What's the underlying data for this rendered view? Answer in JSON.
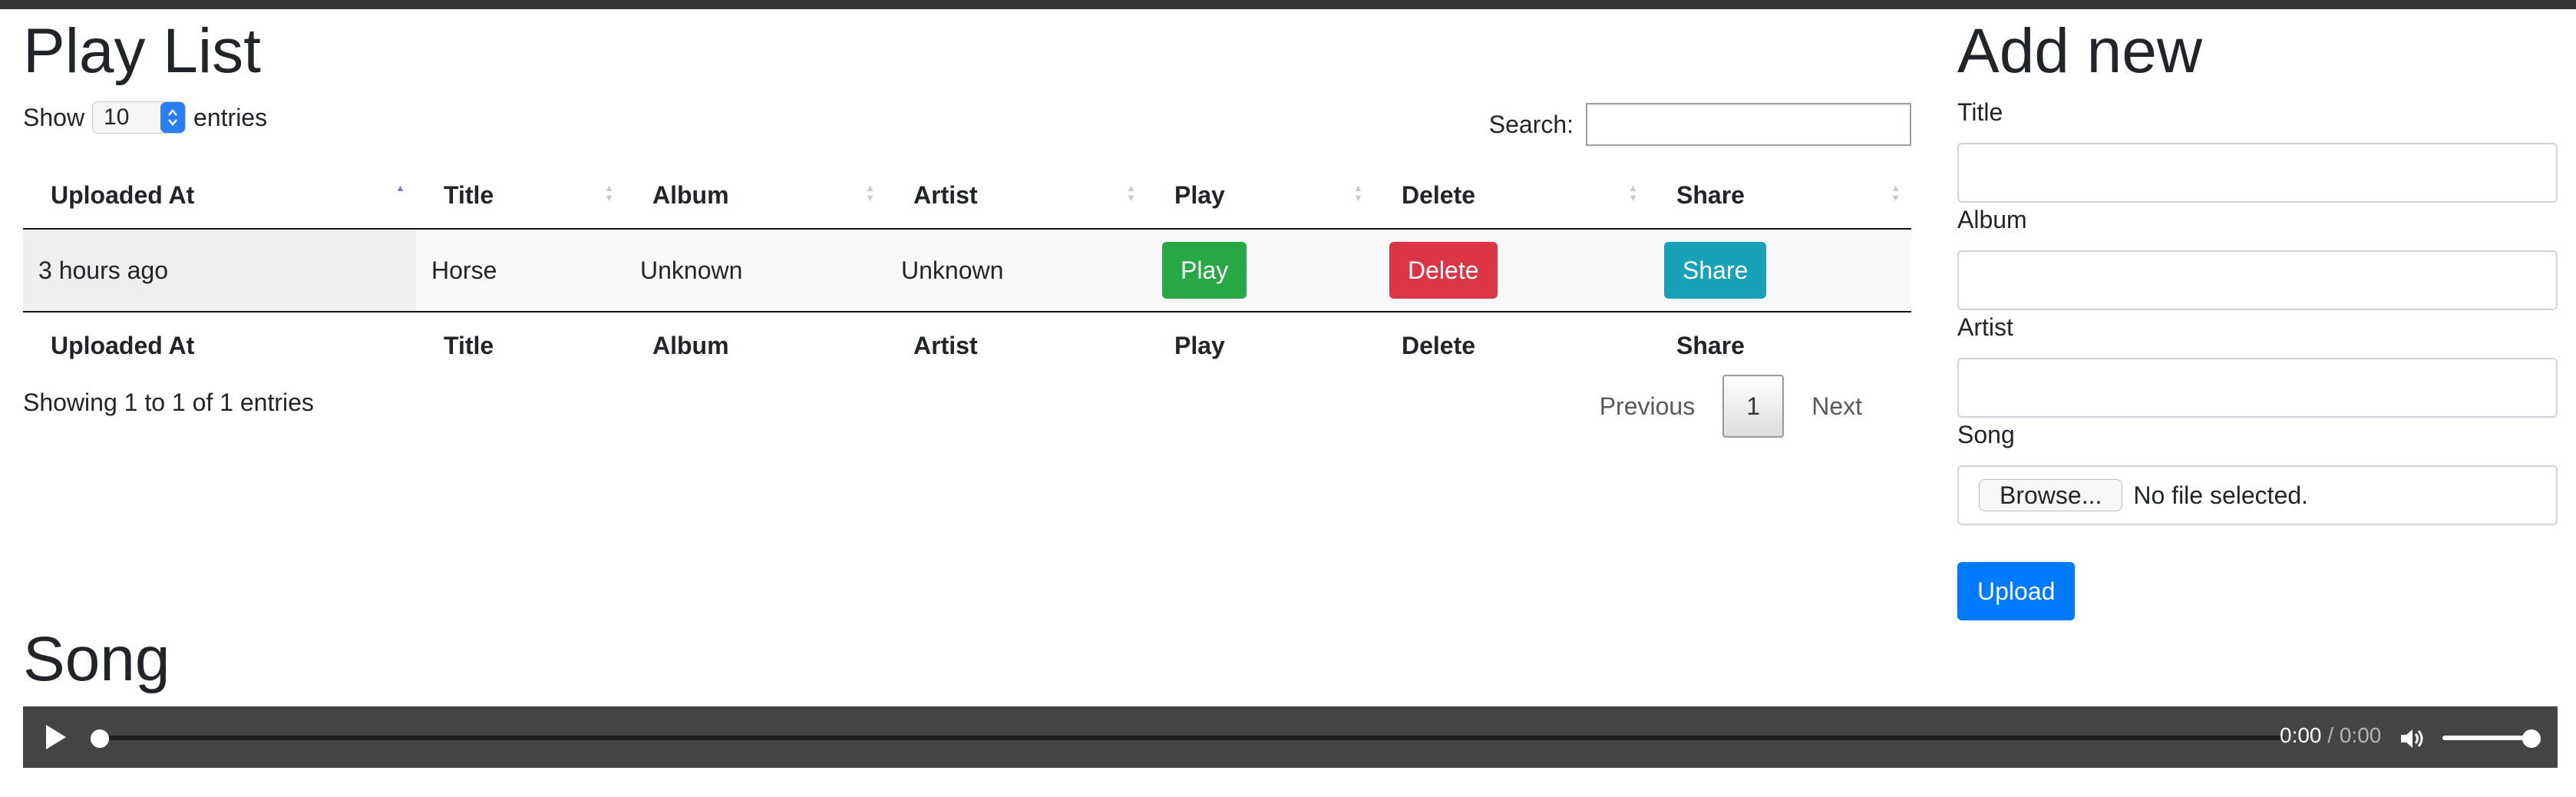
{
  "playlist": {
    "title": "Play List",
    "length": {
      "prefix": "Show",
      "value": "10",
      "suffix": "entries"
    },
    "search_label": "Search:",
    "search_value": "",
    "columns": [
      "Uploaded At",
      "Title",
      "Album",
      "Artist",
      "Play",
      "Delete",
      "Share"
    ],
    "sort": {
      "column": "Uploaded At",
      "direction": "ascending"
    },
    "rows": [
      {
        "uploaded_at": "3 hours ago",
        "title": "Horse",
        "album": "Unknown",
        "artist": "Unknown",
        "play": "Play",
        "delete": "Delete",
        "share": "Share"
      }
    ],
    "info": "Showing 1 to 1 of 1 entries",
    "pagination": {
      "previous": "Previous",
      "current": "1",
      "next": "Next"
    },
    "colors": {
      "play": "#28a745",
      "delete": "#dc3545",
      "share": "#17a2b8"
    }
  },
  "add_new": {
    "title": "Add new",
    "fields": {
      "title": "Title",
      "album": "Album",
      "artist": "Artist",
      "song": "Song"
    },
    "file": {
      "button": "Browse...",
      "status": "No file selected."
    },
    "upload": "Upload",
    "accent": "#007bff"
  },
  "song": {
    "title": "Song",
    "player": {
      "current_time": "0:00",
      "separator": " / ",
      "duration": "0:00",
      "icons": [
        "play-icon",
        "volume-icon"
      ]
    }
  }
}
